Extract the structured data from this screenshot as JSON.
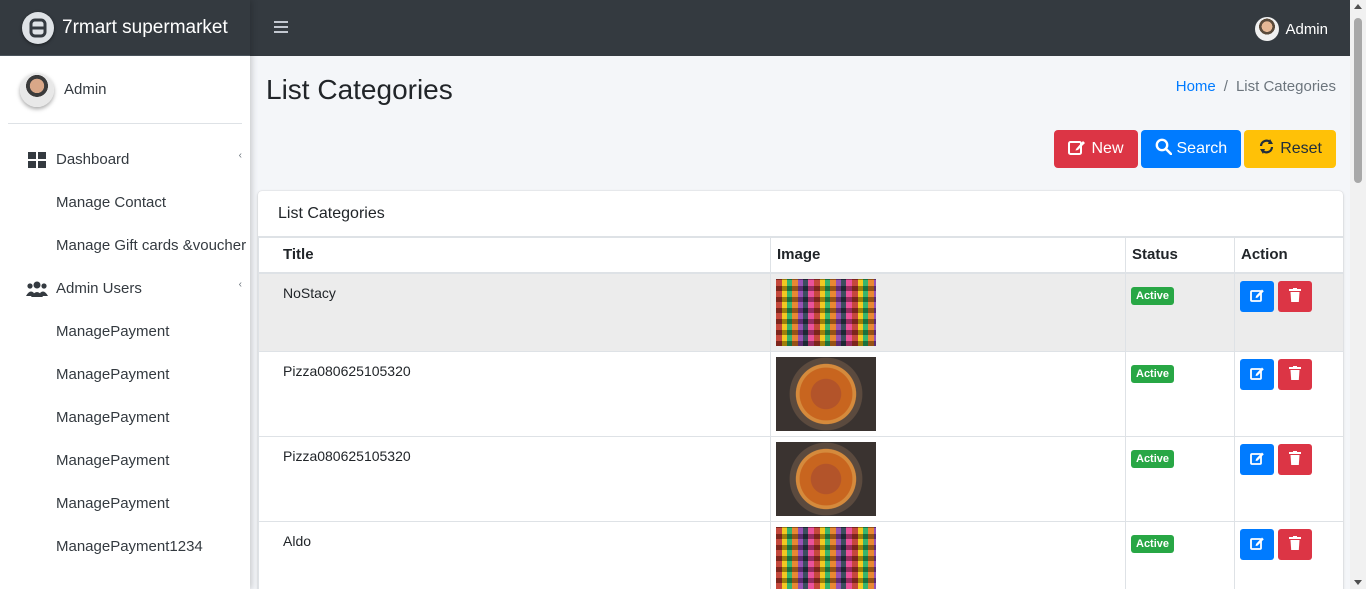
{
  "brand": {
    "name": "7rmart supermarket"
  },
  "sidebar": {
    "user": "Admin",
    "items": [
      {
        "label": "Dashboard",
        "icon": "grid-icon",
        "level": 0
      },
      {
        "label": "Manage Contact",
        "level": 1
      },
      {
        "label": "Manage Gift cards &voucher",
        "level": 1
      },
      {
        "label": "Admin Users",
        "icon": "users-icon",
        "level": 0
      },
      {
        "label": "ManagePayment",
        "level": 1
      },
      {
        "label": "ManagePayment",
        "level": 1
      },
      {
        "label": "ManagePayment",
        "level": 1
      },
      {
        "label": "ManagePayment",
        "level": 1
      },
      {
        "label": "ManagePayment",
        "level": 1
      },
      {
        "label": "ManagePayment1234",
        "level": 1
      }
    ]
  },
  "topbar": {
    "user": "Admin"
  },
  "page": {
    "title": "List Categories",
    "breadcrumb": {
      "home": "Home",
      "separator": "/",
      "current": "List Categories"
    }
  },
  "actions": {
    "new": "New",
    "search": "Search",
    "reset": "Reset"
  },
  "card": {
    "title": "List Categories",
    "columns": [
      "Title",
      "Image",
      "Status",
      "Action"
    ],
    "rows": [
      {
        "title": "NoStacy",
        "image": "market",
        "status": "Active"
      },
      {
        "title": "Pizza080625105320",
        "image": "pizza",
        "status": "Active"
      },
      {
        "title": "Pizza080625105320",
        "image": "pizza",
        "status": "Active"
      },
      {
        "title": "Aldo",
        "image": "market",
        "status": "Active"
      }
    ]
  },
  "colors": {
    "topbar": "#343a40",
    "primary": "#007bff",
    "danger": "#dc3545",
    "warning": "#ffc107",
    "success": "#28a745"
  }
}
